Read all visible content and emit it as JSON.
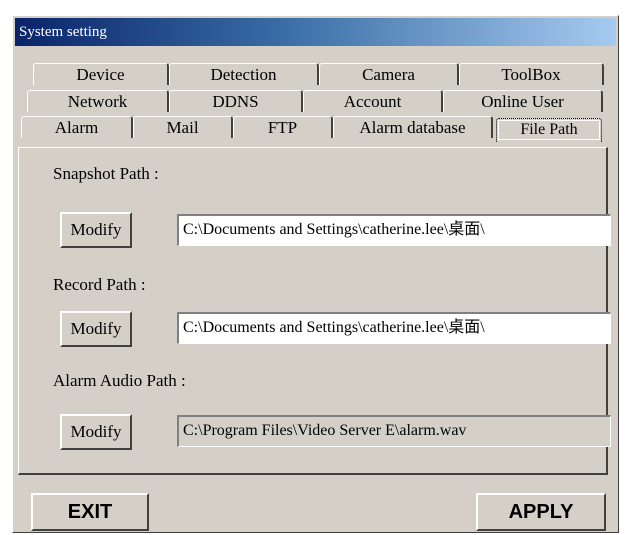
{
  "window": {
    "title": "System setting"
  },
  "tabs": {
    "row1": [
      "Device",
      "Detection",
      "Camera",
      "ToolBox"
    ],
    "row2": [
      "Network",
      "DDNS",
      "Account",
      "Online User"
    ],
    "row3": [
      "Alarm",
      "Mail",
      "FTP",
      "Alarm database",
      "File Path"
    ],
    "active": "File Path"
  },
  "file_path": {
    "snapshot": {
      "label": "Snapshot Path :",
      "button": "Modify",
      "value": "C:\\Documents and Settings\\catherine.lee\\桌面\\"
    },
    "record": {
      "label": "Record Path :",
      "button": "Modify",
      "value": "C:\\Documents and Settings\\catherine.lee\\桌面\\"
    },
    "alarm_audio": {
      "label": "Alarm Audio Path :",
      "button": "Modify",
      "value": "C:\\Program Files\\Video Server E\\alarm.wav"
    }
  },
  "footer": {
    "exit_label": "EXIT",
    "apply_label": "APPLY"
  }
}
